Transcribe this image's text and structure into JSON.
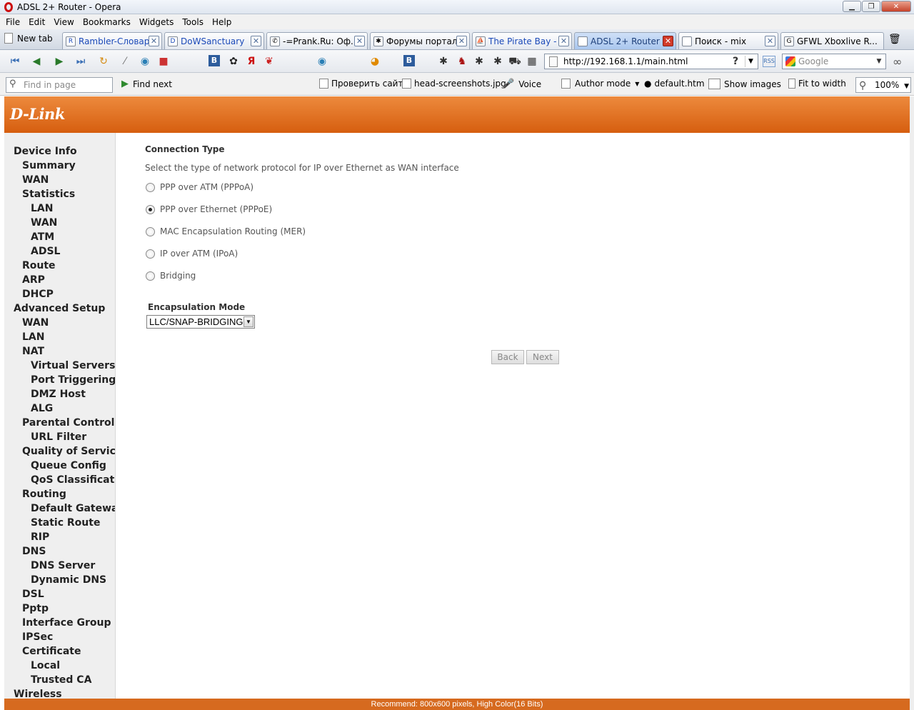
{
  "window": {
    "title": "ADSL 2+ Router - Opera"
  },
  "menu": [
    "File",
    "Edit",
    "View",
    "Bookmarks",
    "Widgets",
    "Tools",
    "Help"
  ],
  "tabs": {
    "new_tab": "New tab",
    "items": [
      {
        "label": "Rambler-Словари"
      },
      {
        "label": "DoWSanctuary"
      },
      {
        "label": "-=Prank.Ru: Оф..."
      },
      {
        "label": "Форумы портал..."
      },
      {
        "label": "The Pirate Bay - ..."
      },
      {
        "label": "ADSL 2+ Router"
      },
      {
        "label": "Поиск - mix"
      },
      {
        "label": "GFWL Xboxlive R..."
      }
    ]
  },
  "address": {
    "url": "http://192.168.1.1/main.html",
    "help": "?"
  },
  "search": {
    "placeholder": "Google"
  },
  "findbar": {
    "placeholder": "Find in page",
    "find_next": "Find next",
    "items": [
      "Проверить сайт!",
      "head-screenshots.jpg",
      "Voice",
      "Author mode",
      "default.htm",
      "Show images",
      "Fit to width"
    ],
    "zoom": "100%"
  },
  "router": {
    "logo": "D-Link",
    "nav": [
      {
        "label": "Device Info",
        "level": 0
      },
      {
        "label": "Summary",
        "level": 1
      },
      {
        "label": "WAN",
        "level": 1
      },
      {
        "label": "Statistics",
        "level": 1
      },
      {
        "label": "LAN",
        "level": 2
      },
      {
        "label": "WAN",
        "level": 2
      },
      {
        "label": "ATM",
        "level": 2
      },
      {
        "label": "ADSL",
        "level": 2
      },
      {
        "label": "Route",
        "level": 1
      },
      {
        "label": "ARP",
        "level": 1
      },
      {
        "label": "DHCP",
        "level": 1
      },
      {
        "label": "Advanced Setup",
        "level": 0
      },
      {
        "label": "WAN",
        "level": 1
      },
      {
        "label": "LAN",
        "level": 1
      },
      {
        "label": "NAT",
        "level": 1
      },
      {
        "label": "Virtual Servers",
        "level": 2
      },
      {
        "label": "Port Triggering",
        "level": 2
      },
      {
        "label": "DMZ Host",
        "level": 2
      },
      {
        "label": "ALG",
        "level": 2
      },
      {
        "label": "Parental Control",
        "level": 1
      },
      {
        "label": "URL Filter",
        "level": 2
      },
      {
        "label": "Quality of Service",
        "level": 1
      },
      {
        "label": "Queue Config",
        "level": 2
      },
      {
        "label": "QoS Classification",
        "level": 2
      },
      {
        "label": "Routing",
        "level": 1
      },
      {
        "label": "Default Gateway",
        "level": 2
      },
      {
        "label": "Static Route",
        "level": 2
      },
      {
        "label": "RIP",
        "level": 2
      },
      {
        "label": "DNS",
        "level": 1
      },
      {
        "label": "DNS Server",
        "level": 2
      },
      {
        "label": "Dynamic DNS",
        "level": 2
      },
      {
        "label": "DSL",
        "level": 1
      },
      {
        "label": "Pptp",
        "level": 1
      },
      {
        "label": "Interface Group",
        "level": 1
      },
      {
        "label": "IPSec",
        "level": 1
      },
      {
        "label": "Certificate",
        "level": 1
      },
      {
        "label": "Local",
        "level": 2
      },
      {
        "label": "Trusted CA",
        "level": 2
      },
      {
        "label": "Wireless",
        "level": 0
      }
    ],
    "connection_type": {
      "title": "Connection Type",
      "description": "Select the type of network protocol for IP over Ethernet as WAN interface",
      "options": [
        {
          "label": "PPP over ATM (PPPoA)",
          "checked": false
        },
        {
          "label": "PPP over Ethernet (PPPoE)",
          "checked": true
        },
        {
          "label": "MAC Encapsulation Routing (MER)",
          "checked": false
        },
        {
          "label": "IP over ATM (IPoA)",
          "checked": false
        },
        {
          "label": "Bridging",
          "checked": false
        }
      ]
    },
    "encapsulation": {
      "label": "Encapsulation Mode",
      "value": "LLC/SNAP-BRIDGING"
    },
    "buttons": {
      "back": "Back",
      "next": "Next"
    },
    "footer": "Recommend: 800x600 pixels, High Color(16 Bits)"
  },
  "colors": {
    "brand_orange": "#e06b18",
    "active_tab": "#a9c6ee"
  }
}
